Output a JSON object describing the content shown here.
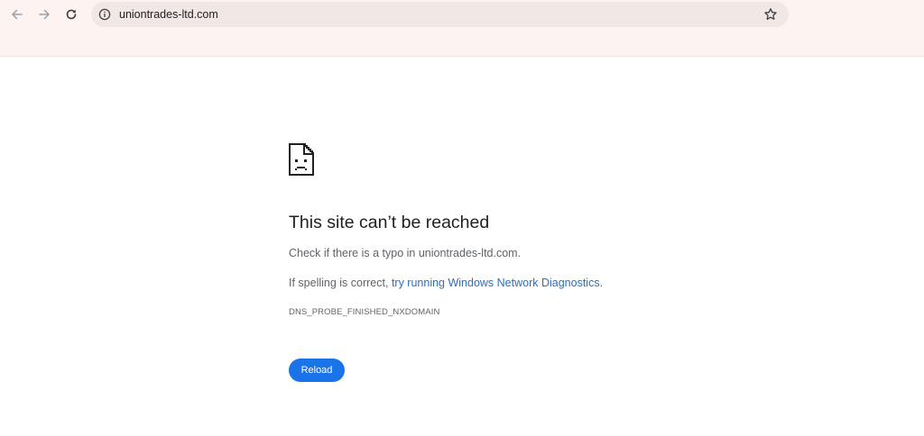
{
  "browser": {
    "url": "uniontrades-ltd.com",
    "icons": {
      "back": "back-arrow-icon",
      "forward": "forward-arrow-icon",
      "reload": "reload-icon",
      "site_info": "info-icon",
      "bookmark": "star-icon"
    }
  },
  "error_page": {
    "icon": "sad-page-icon",
    "title": "This site can’t be reached",
    "typo_message": "Check if there is a typo in uniontrades-ltd.com.",
    "spelling_prefix": "If spelling is correct, ",
    "diagnostics_link": "try running Windows Network Diagnostics",
    "spelling_suffix": ".",
    "error_code": "DNS_PROBE_FINISHED_NXDOMAIN",
    "reload_label": "Reload"
  },
  "colors": {
    "toolbar_bg": "#fdf4f2",
    "omnibox_bg": "#f1e7e5",
    "link": "#2a6fbd",
    "button": "#1a73e8"
  }
}
